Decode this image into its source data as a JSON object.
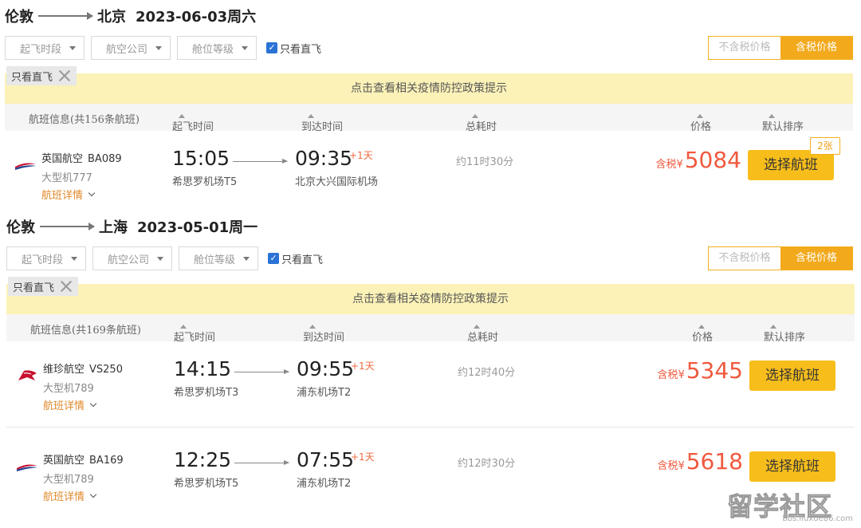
{
  "sections": [
    {
      "origin": "伦敦",
      "destination": "北京",
      "date": "2023-06-03周六",
      "filters": {
        "departure_period": "起飞时段",
        "airline": "航空公司",
        "cabin": "舱位等级",
        "direct_only": "只看直飞"
      },
      "tax_toggle": {
        "exclude": "不含税价格",
        "include": "含税价格"
      },
      "chip": "只看直飞",
      "notice": "点击查看相关疫情防控政策提示",
      "headers": {
        "flight_info": "航班信息(共156条航班)",
        "depart": "起飞时间",
        "arrive": "到达时间",
        "duration": "总耗时",
        "price": "价格",
        "sort": "默认排序"
      },
      "flights": [
        {
          "airline": "英国航空",
          "flight_no": "BA089",
          "aircraft": "大型机777",
          "detail": "航班详情",
          "dep_time": "15:05",
          "dep_airport": "希思罗机场T5",
          "arr_time": "09:35",
          "plus_day": "+1天",
          "arr_airport": "北京大兴国际机场",
          "duration": "约11时30分",
          "price_label": "含税¥",
          "price": "5084",
          "button": "选择航班",
          "seats": "2张",
          "logo": "british-airways-logo-icon"
        }
      ]
    },
    {
      "origin": "伦敦",
      "destination": "上海",
      "date": "2023-05-01周一",
      "filters": {
        "departure_period": "起飞时段",
        "airline": "航空公司",
        "cabin": "舱位等级",
        "direct_only": "只看直飞"
      },
      "tax_toggle": {
        "exclude": "不含税价格",
        "include": "含税价格"
      },
      "chip": "只看直飞",
      "notice": "点击查看相关疫情防控政策提示",
      "headers": {
        "flight_info": "航班信息(共169条航班)",
        "depart": "起飞时间",
        "arrive": "到达时间",
        "duration": "总耗时",
        "price": "价格",
        "sort": "默认排序"
      },
      "flights": [
        {
          "airline": "维珍航空",
          "flight_no": "VS250",
          "aircraft": "大型机789",
          "detail": "航班详情",
          "dep_time": "14:15",
          "dep_airport": "希思罗机场T3",
          "arr_time": "09:55",
          "plus_day": "+1天",
          "arr_airport": "浦东机场T2",
          "duration": "约12时40分",
          "price_label": "含税¥",
          "price": "5345",
          "button": "选择航班",
          "logo": "virgin-atlantic-logo-icon"
        },
        {
          "airline": "英国航空",
          "flight_no": "BA169",
          "aircraft": "大型机789",
          "detail": "航班详情",
          "dep_time": "12:25",
          "dep_airport": "希思罗机场T5",
          "arr_time": "07:55",
          "plus_day": "+1天",
          "arr_airport": "浦东机场T2",
          "duration": "约12时30分",
          "price_label": "含税¥",
          "price": "5618",
          "button": "选择航班",
          "logo": "british-airways-logo-icon"
        }
      ]
    }
  ],
  "watermark": {
    "text": "留学社区",
    "url": "bbs.liuxue86.com"
  },
  "colors": {
    "accent": "#f7be1b",
    "price": "#f0593e",
    "notice_bg": "#fcf2b8",
    "checkbox": "#2a73d6"
  }
}
